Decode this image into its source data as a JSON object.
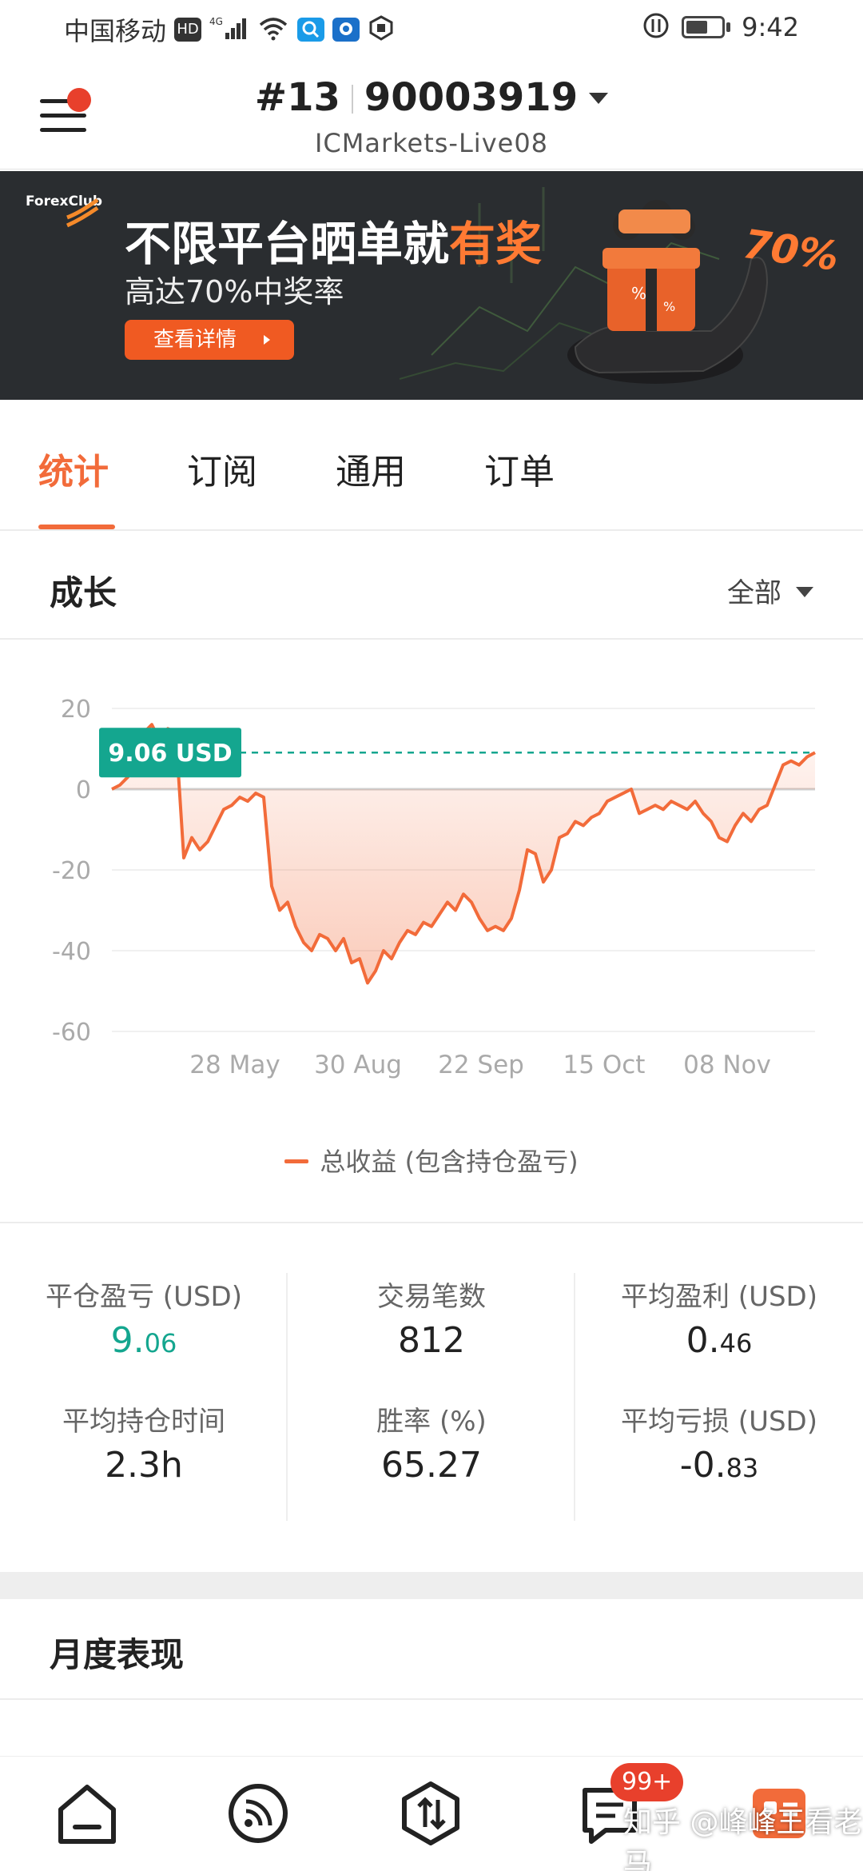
{
  "status_bar": {
    "carrier": "中国移动",
    "hd": "HD",
    "network": "4G",
    "time": "9:42"
  },
  "header": {
    "account_number": "#13",
    "account_id": "90003919",
    "server": "ICMarkets-Live08"
  },
  "banner": {
    "logo": "ForexClub",
    "title_main": "不限平台晒单就",
    "title_highlight": "有奖",
    "subtitle": "高达70%中奖率",
    "button_label": "查看详情",
    "badge_percent": "70%"
  },
  "tabs": [
    {
      "label": "统计",
      "active": true
    },
    {
      "label": "订阅",
      "active": false
    },
    {
      "label": "通用",
      "active": false
    },
    {
      "label": "订单",
      "active": false
    }
  ],
  "growth": {
    "title": "成长",
    "range": "全部"
  },
  "chart_data": {
    "type": "area",
    "ylim": [
      -60,
      20
    ],
    "yticks": [
      20,
      0,
      -20,
      -40,
      -60
    ],
    "xticks": [
      "28 May",
      "30 Aug",
      "22 Sep",
      "15 Oct",
      "08 Nov"
    ],
    "current_label": "9.06 USD",
    "current_value": 9.06,
    "legend": "总收益 (包含持仓盈亏)",
    "series": [
      {
        "name": "总收益 (包含持仓盈亏)",
        "color": "#f26b3a",
        "values": [
          0,
          1,
          3,
          8,
          14,
          16,
          12,
          15,
          14,
          -17,
          -12,
          -15,
          -13,
          -9,
          -5,
          -4,
          -2,
          -3,
          -1,
          -2,
          -24,
          -30,
          -28,
          -34,
          -38,
          -40,
          -36,
          -37,
          -40,
          -37,
          -43,
          -42,
          -48,
          -45,
          -40,
          -42,
          -38,
          -35,
          -36,
          -33,
          -34,
          -31,
          -28,
          -30,
          -26,
          -28,
          -32,
          -35,
          -34,
          -35,
          -32,
          -25,
          -15,
          -16,
          -23,
          -20,
          -12,
          -11,
          -8,
          -9,
          -7,
          -6,
          -3,
          -2,
          -1,
          0,
          -6,
          -5,
          -4,
          -5,
          -3,
          -4,
          -5,
          -3,
          -6,
          -8,
          -12,
          -13,
          -9,
          -6,
          -8,
          -5,
          -4,
          1,
          6,
          7,
          6,
          8,
          9.06
        ]
      }
    ]
  },
  "stats": [
    {
      "label": "平仓盈亏 (USD)",
      "value_int": "9.",
      "value_dec": "06",
      "color": "green"
    },
    {
      "label": "交易笔数",
      "value_int": "812",
      "value_dec": "",
      "color": "default"
    },
    {
      "label": "平均盈利 (USD)",
      "value_int": "0.",
      "value_dec": "46",
      "color": "default"
    },
    {
      "label": "平均持仓时间",
      "value_int": "2.3h",
      "value_dec": "",
      "color": "default"
    },
    {
      "label": "胜率 (%)",
      "value_int": "65.27",
      "value_dec": "",
      "color": "default"
    },
    {
      "label": "平均亏损 (USD)",
      "value_int": "-0.",
      "value_dec": "83",
      "color": "default"
    }
  ],
  "monthly": {
    "title": "月度表现"
  },
  "bottom_nav": {
    "items": [
      {
        "icon": "home-icon"
      },
      {
        "icon": "feed-icon"
      },
      {
        "icon": "trade-icon"
      },
      {
        "icon": "orders-icon"
      },
      {
        "icon": "profile-icon"
      }
    ],
    "badge": "99+"
  },
  "watermark": "知乎 @峰峰王看老马"
}
